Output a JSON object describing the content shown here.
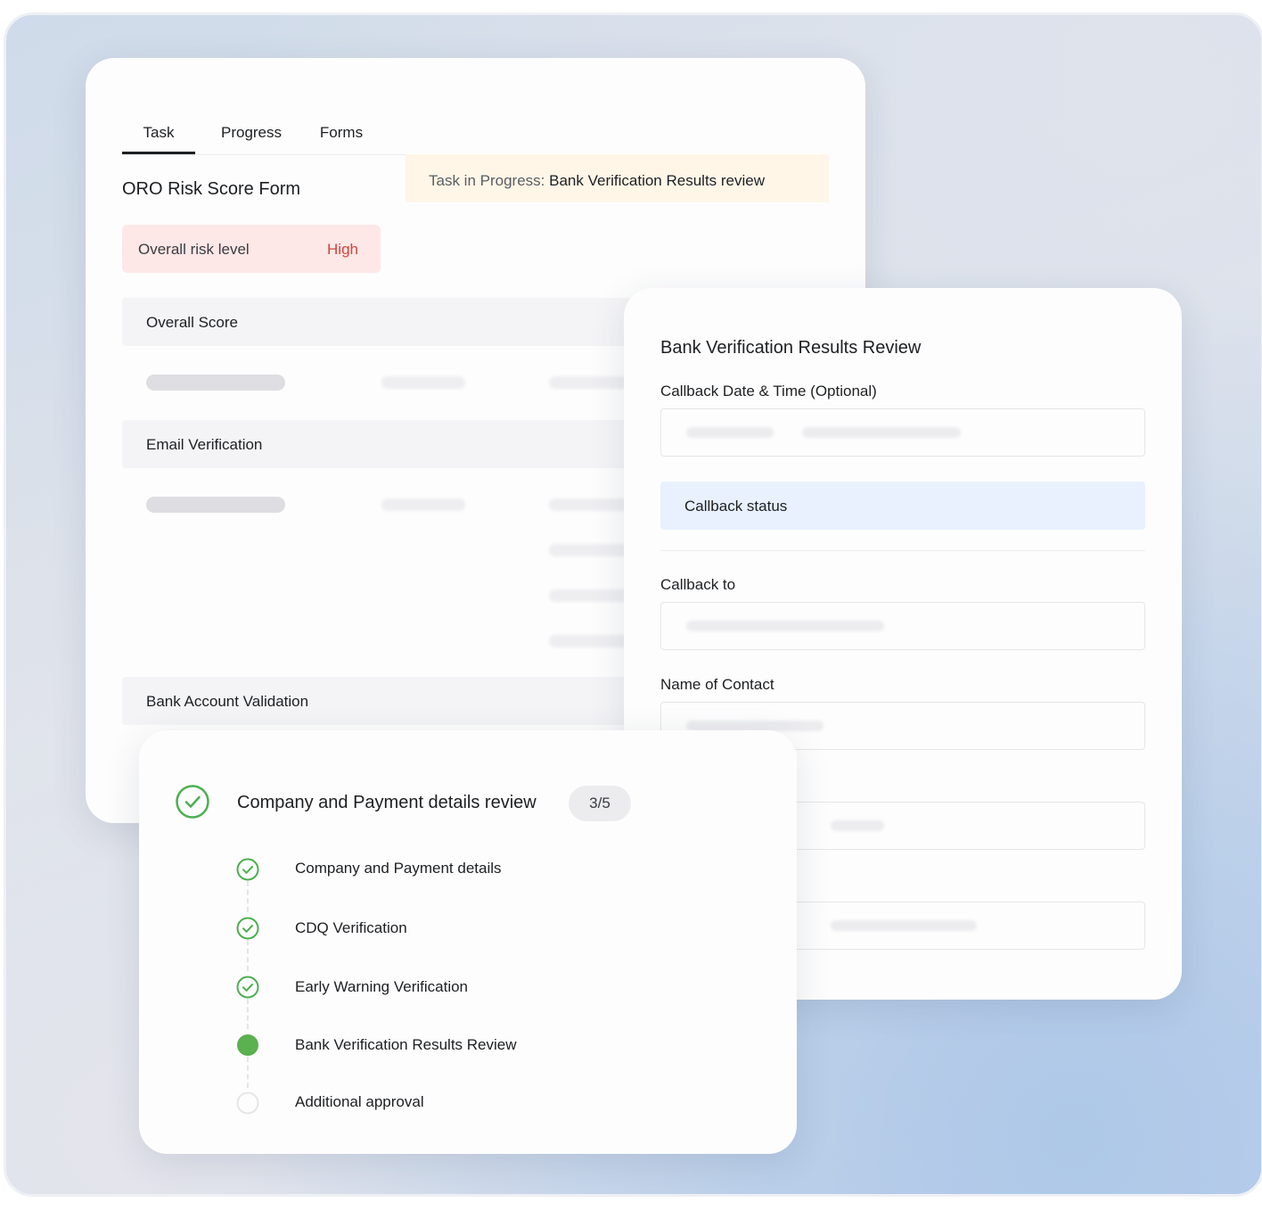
{
  "risk_card": {
    "tabs": [
      "Task",
      "Progress",
      "Forms"
    ],
    "active_tab": "Task",
    "task_banner": {
      "prefix": "Task in Progress:",
      "task_name": "Bank Verification Results review"
    },
    "form_title": "ORO Risk Score Form",
    "risk": {
      "label": "Overall risk level",
      "value": "High"
    },
    "sections": [
      "Overall Score",
      "Email Verification",
      "Bank Account Validation"
    ]
  },
  "bank_card": {
    "title": "Bank Verification Results Review",
    "fields": {
      "callback_date_label": "Callback Date & Time (Optional)",
      "callback_status_label": "Callback status",
      "callback_to_label": "Callback to",
      "name_of_contact_label": "Name of Contact"
    }
  },
  "steps_card": {
    "title": "Company and Payment details review",
    "counter": "3/5",
    "steps": [
      {
        "label": "Company and Payment details",
        "status": "done"
      },
      {
        "label": "CDQ Verification",
        "status": "done"
      },
      {
        "label": "Early Warning Verification",
        "status": "done"
      },
      {
        "label": "Bank Verification Results Review",
        "status": "current"
      },
      {
        "label": "Additional approval",
        "status": "pending"
      }
    ]
  },
  "colors": {
    "risk_high": "#d0453a",
    "risk_bg": "#fde7e7",
    "success_green": "#4caf50",
    "banner_bg": "#fff6e8",
    "status_bg": "#e8f1fd"
  }
}
